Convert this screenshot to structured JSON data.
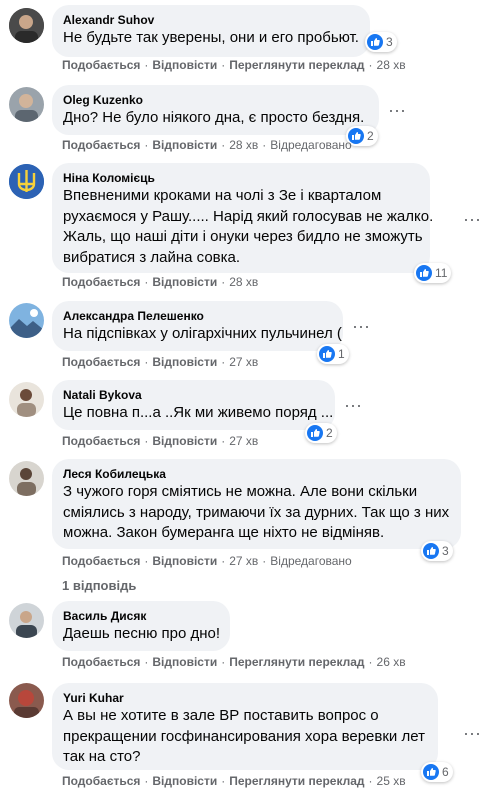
{
  "labels": {
    "like": "Подобається",
    "reply": "Відповісти",
    "translate": "Переглянути переклад",
    "edited": "Відредаговано",
    "sep": "·",
    "more": "···"
  },
  "colors": {
    "like_blue": "#1877f2",
    "bubble": "#f0f2f5",
    "meta": "#65676b"
  },
  "comments": [
    {
      "name": "Alexandr  Suhov",
      "lines": [
        "Не будьте так уверены, они и его пробьют."
      ],
      "reactions": "3",
      "time": "28 хв",
      "translate": true,
      "edited": false
    },
    {
      "name": "Oleg Kuzenko",
      "lines": [
        "Дно? Не було ніякого дна, є просто бездня."
      ],
      "reactions": "2",
      "time": "28 хв",
      "translate": false,
      "edited": true
    },
    {
      "name": "Ніна Коломієць",
      "lines": [
        "Впевненими кроками на чолі з Зе і кварталом",
        "рухаємося у Рашу..... Нарід який голосував не жалко.",
        "Жаль, що наші діти і онуки через бидло не зможуть",
        "вибратися з лайна совка."
      ],
      "reactions": "11",
      "time": "28 хв",
      "translate": false,
      "edited": false
    },
    {
      "name": "Александра Пелешенко",
      "lines": [
        "На підспівках у олігархічних пульчинел ("
      ],
      "reactions": "1",
      "time": "27 хв",
      "translate": false,
      "edited": false
    },
    {
      "name": "Natali Bykova",
      "lines": [
        "Це повна п...а ..Як ми живемо поряд ..."
      ],
      "reactions": "2",
      "time": "27 хв",
      "translate": false,
      "edited": false
    },
    {
      "name": "Леся Кобилецька",
      "lines": [
        "З чужого горя сміятись не можна. Але вони скільки",
        "сміялись з народу, тримаючи їх за дурних. Так що з них",
        "можна. Закон бумеранга ще ніхто не відміняв."
      ],
      "reactions": "3",
      "time": "27 хв",
      "translate": false,
      "edited": true
    },
    {
      "name": "Василь Дисяк",
      "lines": [
        "Даешь песню про дно!"
      ],
      "reactions": "",
      "time": "26 хв",
      "translate": true,
      "edited": false
    },
    {
      "name": "Yuri Kuhar",
      "lines": [
        "А вы не хотите в зале ВР поставить вопрос о",
        "прекращении госфинансирования хора веревки лет",
        "так на сто?"
      ],
      "reactions": "6",
      "time": "25 хв",
      "translate": true,
      "edited": false
    }
  ],
  "replies_link": "1 відповідь"
}
